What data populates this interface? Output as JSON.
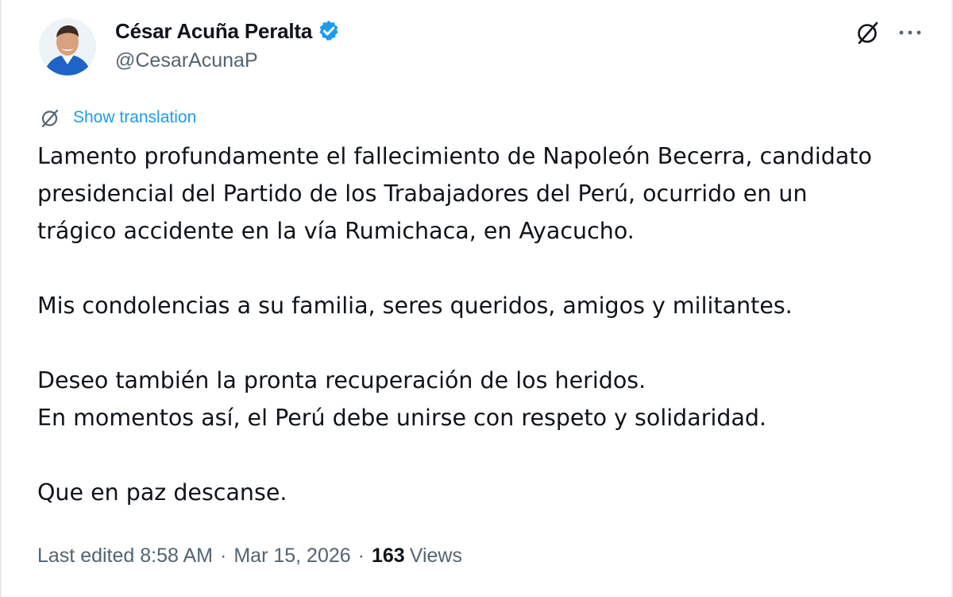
{
  "author": {
    "display_name": "César Acuña Peralta",
    "handle": "@CesarAcunaP",
    "verified": true,
    "verified_color": "#1d9bf0",
    "avatar_icon": "user-avatar"
  },
  "header_actions": {
    "grok_icon": "grok-slash-circle-icon",
    "more_icon": "more-horizontal-icon"
  },
  "translate": {
    "icon": "grok-slash-circle-icon",
    "label": "Show translation",
    "color": "#1d9bf0"
  },
  "post": {
    "lines": [
      "Lamento profundamente el fallecimiento de Napoleón Becerra, candidato",
      "presidencial del Partido de los Trabajadores del Perú, ocurrido en un",
      "trágico accidente en la vía Rumichaca, en Ayacucho.",
      "Mis condolencias a su familia, seres queridos, amigos y militantes.",
      "Deseo también la pronta recuperación de los heridos.",
      "En momentos así, el Perú debe unirse con respeto y solidaridad.",
      "Que en paz descanse."
    ]
  },
  "meta": {
    "edited_label": "Last edited",
    "time": "8:58 AM",
    "separator": "·",
    "date": "Mar 15, 2026",
    "views_count": "163",
    "views_label": "Views"
  }
}
